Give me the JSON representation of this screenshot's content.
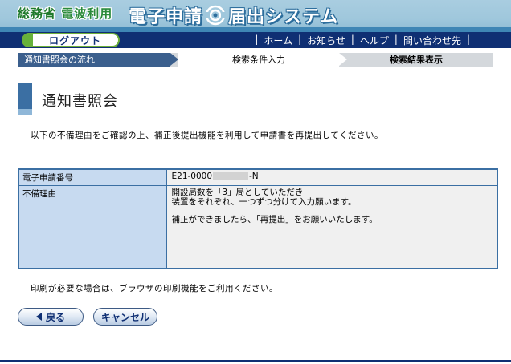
{
  "header": {
    "ministry_part1": "総務省",
    "ministry_part2": "電波利用",
    "logo_part1": "電子申請",
    "logo_part2": "届出システム"
  },
  "navbar": {
    "logout_label": "ログアウト",
    "links": [
      "ホーム",
      "お知らせ",
      "ヘルプ",
      "問い合わせ先"
    ],
    "separator": "|"
  },
  "steps": {
    "step1": "通知書照会の流れ",
    "step2": "検索条件入力",
    "step3": "検索結果表示"
  },
  "page": {
    "title": "通知書照会",
    "instruction": "以下の不備理由をご確認の上、補正後提出機能を利用して申請書を再提出してください。",
    "print_note": "印刷が必要な場合は、ブラウザの印刷機能をご利用ください。"
  },
  "table": {
    "row1_label": "電子申請番号",
    "row1_value_prefix": "E21-0000",
    "row1_value_suffix": "-N",
    "row2_label": "不備理由",
    "reason_lines": [
      "開設局数を「3」局としていただき",
      "装置をそれぞれ、一つずつ分けて入力願います。"
    ],
    "reason_line3": "補正ができましたら、「再提出」をお願いいたします。"
  },
  "buttons": {
    "back_label": "戻る",
    "cancel_label": "キャンセル"
  }
}
